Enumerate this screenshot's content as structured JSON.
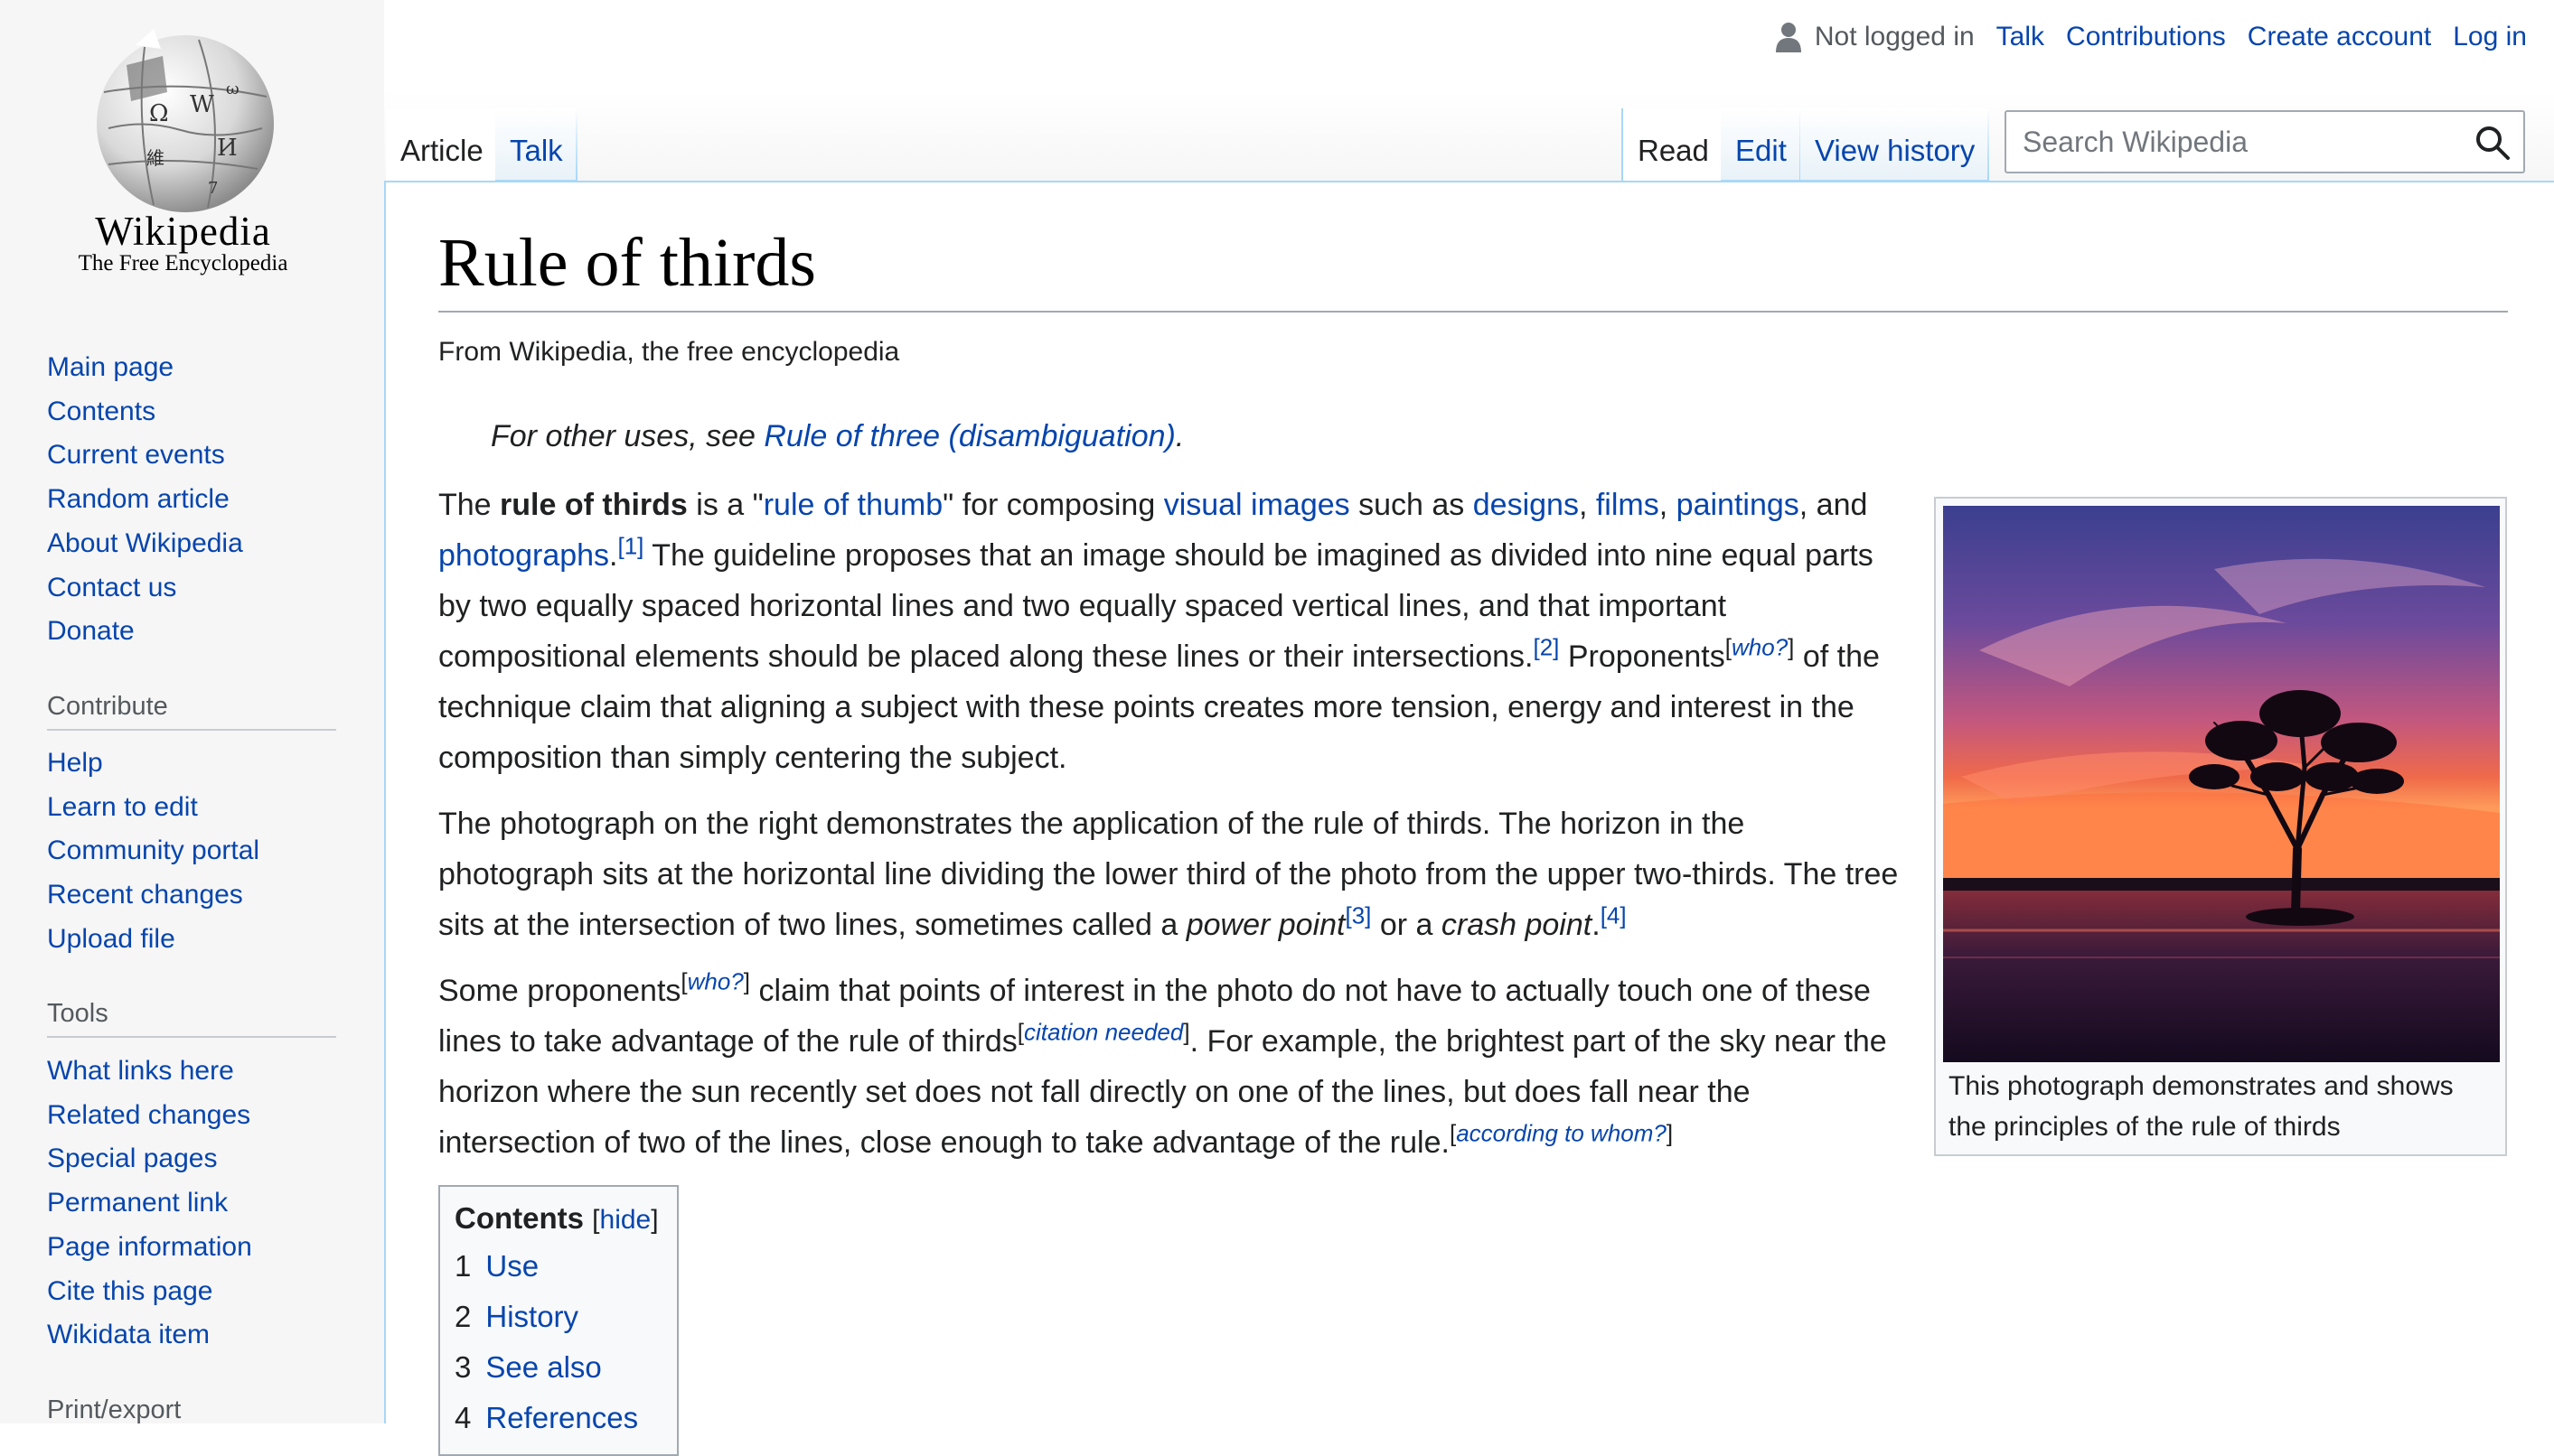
{
  "logo": {
    "wordmark": "Wikipedia",
    "tagline": "The Free Encyclopedia"
  },
  "sidebar": {
    "navigation": [
      "Main page",
      "Contents",
      "Current events",
      "Random article",
      "About Wikipedia",
      "Contact us",
      "Donate"
    ],
    "contribute_heading": "Contribute",
    "contribute": [
      "Help",
      "Learn to edit",
      "Community portal",
      "Recent changes",
      "Upload file"
    ],
    "tools_heading": "Tools",
    "tools": [
      "What links here",
      "Related changes",
      "Special pages",
      "Permanent link",
      "Page information",
      "Cite this page",
      "Wikidata item"
    ],
    "print_heading": "Print/export"
  },
  "personal": {
    "status": "Not logged in",
    "talk": "Talk",
    "contributions": "Contributions",
    "create_account": "Create account",
    "login": "Log in"
  },
  "tabs": {
    "article": "Article",
    "talk": "Talk",
    "read": "Read",
    "edit": "Edit",
    "view_history": "View history"
  },
  "search": {
    "placeholder": "Search Wikipedia"
  },
  "article": {
    "title": "Rule of thirds",
    "tagline": "From Wikipedia, the free encyclopedia",
    "hatnote_prefix": "For other uses, see ",
    "hatnote_link": "Rule of three (disambiguation)",
    "hatnote_suffix": ".",
    "p1": {
      "t1": "The ",
      "bold": "rule of thirds",
      "t2": " is a \"",
      "l1": "rule of thumb",
      "t3": "\" for composing ",
      "l2": "visual images",
      "t4": " such as ",
      "l3": "designs",
      "t5": ", ",
      "l4": "films",
      "t6": ", ",
      "l5": "paintings",
      "t7": ", and ",
      "l6": "photographs",
      "t8": ".",
      "ref1": "[1]",
      "t9": " The guideline proposes that an image should be imagined as divided into nine equal parts by two equally spaced horizontal lines and two equally spaced vertical lines, and that important compositional elements should be placed along these lines or their intersections.",
      "ref2": "[2]",
      "t10": " Proponents",
      "who_open": "[",
      "who": "who?",
      "who_close": "]",
      "t11": " of the technique claim that aligning a subject with these points creates more tension, energy and interest in the composition than simply centering the subject."
    },
    "p2": {
      "t1": "The photograph on the right demonstrates the application of the rule of thirds. The horizon in the photograph sits at the horizontal line dividing the lower third of the photo from the upper two-thirds. The tree sits at the intersection of two lines, sometimes called a ",
      "i1": "power point",
      "ref3": "[3]",
      "t2": " or a ",
      "i2": "crash point",
      "t3": ".",
      "ref4": "[4]"
    },
    "p3": {
      "t1": "Some proponents",
      "who": "who?",
      "t2": " claim that points of interest in the photo do not have to actually touch one of these lines to take advantage of the rule of thirds",
      "cn": "citation needed",
      "t3": ". For example, the brightest part of the sky near the horizon where the sun recently set does not fall directly on one of the lines, but does fall near the intersection of two of the lines, close enough to take advantage of the rule.",
      "atw": "according to whom?"
    },
    "thumb_caption": "This photograph demonstrates and shows the principles of the rule of thirds"
  },
  "toc": {
    "title": "Contents",
    "hide_open": "[",
    "hide": "hide",
    "hide_close": "]",
    "items": [
      {
        "num": "1",
        "label": "Use"
      },
      {
        "num": "2",
        "label": "History"
      },
      {
        "num": "3",
        "label": "See also"
      },
      {
        "num": "4",
        "label": "References"
      }
    ]
  },
  "colors": {
    "link": "#0645ad",
    "text": "#202122",
    "border": "#a2a9b1",
    "tab_border": "#a7d7f9"
  },
  "icons": [
    "user-icon",
    "search-icon",
    "wikipedia-globe-logo"
  ]
}
